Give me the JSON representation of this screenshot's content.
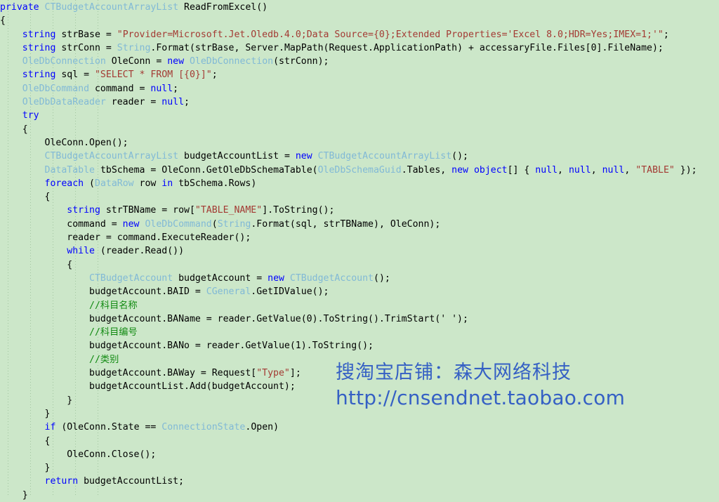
{
  "editor": {
    "background_color": "#cce7c9",
    "language": "C#",
    "syntax_colors": {
      "keyword": "#0000ff",
      "type": "#81b9d6",
      "string": "#a33a33",
      "comment": "#118a11",
      "plain": "#000000"
    },
    "indent_guide_color": "#9bbf99",
    "indent_guide_x_positions": [
      11,
      43,
      75,
      107,
      139
    ],
    "code_lines": [
      [
        {
          "t": "kw",
          "s": "private"
        },
        {
          "t": "pln",
          "s": " "
        },
        {
          "t": "typ",
          "s": "CTBudgetAccountArrayList"
        },
        {
          "t": "pln",
          "s": " ReadFromExcel()"
        }
      ],
      [
        {
          "t": "pln",
          "s": "{"
        }
      ],
      [
        {
          "t": "pln",
          "s": "    "
        },
        {
          "t": "kw",
          "s": "string"
        },
        {
          "t": "pln",
          "s": " strBase = "
        },
        {
          "t": "str",
          "s": "\"Provider=Microsoft.Jet.Oledb.4.0;Data Source={0};Extended Properties='Excel 8.0;HDR=Yes;IMEX=1;'\""
        },
        {
          "t": "pln",
          "s": ";"
        }
      ],
      [
        {
          "t": "pln",
          "s": "    "
        },
        {
          "t": "kw",
          "s": "string"
        },
        {
          "t": "pln",
          "s": " strConn = "
        },
        {
          "t": "typ",
          "s": "String"
        },
        {
          "t": "pln",
          "s": ".Format(strBase, Server.MapPath(Request.ApplicationPath) + accessaryFile.Files[0].FileName);"
        }
      ],
      [
        {
          "t": "pln",
          "s": "    "
        },
        {
          "t": "typ",
          "s": "OleDbConnection"
        },
        {
          "t": "pln",
          "s": " OleConn = "
        },
        {
          "t": "kw",
          "s": "new"
        },
        {
          "t": "pln",
          "s": " "
        },
        {
          "t": "typ",
          "s": "OleDbConnection"
        },
        {
          "t": "pln",
          "s": "(strConn);"
        }
      ],
      [
        {
          "t": "pln",
          "s": "    "
        },
        {
          "t": "kw",
          "s": "string"
        },
        {
          "t": "pln",
          "s": " sql = "
        },
        {
          "t": "str",
          "s": "\"SELECT * FROM [{0}]\""
        },
        {
          "t": "pln",
          "s": ";"
        }
      ],
      [
        {
          "t": "pln",
          "s": "    "
        },
        {
          "t": "typ",
          "s": "OleDbCommand"
        },
        {
          "t": "pln",
          "s": " command = "
        },
        {
          "t": "kw",
          "s": "null"
        },
        {
          "t": "pln",
          "s": ";"
        }
      ],
      [
        {
          "t": "pln",
          "s": "    "
        },
        {
          "t": "typ",
          "s": "OleDbDataReader"
        },
        {
          "t": "pln",
          "s": " reader = "
        },
        {
          "t": "kw",
          "s": "null"
        },
        {
          "t": "pln",
          "s": ";"
        }
      ],
      [
        {
          "t": "pln",
          "s": "    "
        },
        {
          "t": "kw",
          "s": "try"
        }
      ],
      [
        {
          "t": "pln",
          "s": "    {"
        }
      ],
      [
        {
          "t": "pln",
          "s": "        OleConn.Open();"
        }
      ],
      [
        {
          "t": "pln",
          "s": "        "
        },
        {
          "t": "typ",
          "s": "CTBudgetAccountArrayList"
        },
        {
          "t": "pln",
          "s": " budgetAccountList = "
        },
        {
          "t": "kw",
          "s": "new"
        },
        {
          "t": "pln",
          "s": " "
        },
        {
          "t": "typ",
          "s": "CTBudgetAccountArrayList"
        },
        {
          "t": "pln",
          "s": "();"
        }
      ],
      [
        {
          "t": "pln",
          "s": "        "
        },
        {
          "t": "typ",
          "s": "DataTable"
        },
        {
          "t": "pln",
          "s": " tbSchema = OleConn.GetOleDbSchemaTable("
        },
        {
          "t": "typ",
          "s": "OleDbSchemaGuid"
        },
        {
          "t": "pln",
          "s": ".Tables, "
        },
        {
          "t": "kw",
          "s": "new"
        },
        {
          "t": "pln",
          "s": " "
        },
        {
          "t": "kw",
          "s": "object"
        },
        {
          "t": "pln",
          "s": "[] { "
        },
        {
          "t": "kw",
          "s": "null"
        },
        {
          "t": "pln",
          "s": ", "
        },
        {
          "t": "kw",
          "s": "null"
        },
        {
          "t": "pln",
          "s": ", "
        },
        {
          "t": "kw",
          "s": "null"
        },
        {
          "t": "pln",
          "s": ", "
        },
        {
          "t": "str",
          "s": "\"TABLE\""
        },
        {
          "t": "pln",
          "s": " });"
        }
      ],
      [
        {
          "t": "pln",
          "s": "        "
        },
        {
          "t": "kw",
          "s": "foreach"
        },
        {
          "t": "pln",
          "s": " ("
        },
        {
          "t": "typ",
          "s": "DataRow"
        },
        {
          "t": "pln",
          "s": " row "
        },
        {
          "t": "kw",
          "s": "in"
        },
        {
          "t": "pln",
          "s": " tbSchema.Rows)"
        }
      ],
      [
        {
          "t": "pln",
          "s": "        {"
        }
      ],
      [
        {
          "t": "pln",
          "s": "            "
        },
        {
          "t": "kw",
          "s": "string"
        },
        {
          "t": "pln",
          "s": " strTBName = row["
        },
        {
          "t": "str",
          "s": "\"TABLE_NAME\""
        },
        {
          "t": "pln",
          "s": "].ToString();"
        }
      ],
      [
        {
          "t": "pln",
          "s": "            command = "
        },
        {
          "t": "kw",
          "s": "new"
        },
        {
          "t": "pln",
          "s": " "
        },
        {
          "t": "typ",
          "s": "OleDbCommand"
        },
        {
          "t": "pln",
          "s": "("
        },
        {
          "t": "typ",
          "s": "String"
        },
        {
          "t": "pln",
          "s": ".Format(sql, strTBName), OleConn);"
        }
      ],
      [
        {
          "t": "pln",
          "s": "            reader = command.ExecuteReader();"
        }
      ],
      [
        {
          "t": "pln",
          "s": "            "
        },
        {
          "t": "kw",
          "s": "while"
        },
        {
          "t": "pln",
          "s": " (reader.Read())"
        }
      ],
      [
        {
          "t": "pln",
          "s": "            {"
        }
      ],
      [
        {
          "t": "pln",
          "s": "                "
        },
        {
          "t": "typ",
          "s": "CTBudgetAccount"
        },
        {
          "t": "pln",
          "s": " budgetAccount = "
        },
        {
          "t": "kw",
          "s": "new"
        },
        {
          "t": "pln",
          "s": " "
        },
        {
          "t": "typ",
          "s": "CTBudgetAccount"
        },
        {
          "t": "pln",
          "s": "();"
        }
      ],
      [
        {
          "t": "pln",
          "s": "                budgetAccount.BAID = "
        },
        {
          "t": "typ",
          "s": "CGeneral"
        },
        {
          "t": "pln",
          "s": ".GetIDValue();"
        }
      ],
      [
        {
          "t": "pln",
          "s": "                "
        },
        {
          "t": "com",
          "s": "//科目名称"
        }
      ],
      [
        {
          "t": "pln",
          "s": "                budgetAccount.BAName = reader.GetValue(0).ToString().TrimStart(' ');"
        }
      ],
      [
        {
          "t": "pln",
          "s": "                "
        },
        {
          "t": "com",
          "s": "//科目编号"
        }
      ],
      [
        {
          "t": "pln",
          "s": "                budgetAccount.BANo = reader.GetValue(1).ToString();"
        }
      ],
      [
        {
          "t": "pln",
          "s": "                "
        },
        {
          "t": "com",
          "s": "//类别"
        }
      ],
      [
        {
          "t": "pln",
          "s": "                budgetAccount.BAWay = Request["
        },
        {
          "t": "str",
          "s": "\"Type\""
        },
        {
          "t": "pln",
          "s": "];"
        }
      ],
      [
        {
          "t": "pln",
          "s": "                budgetAccountList.Add(budgetAccount);"
        }
      ],
      [
        {
          "t": "pln",
          "s": "            }"
        }
      ],
      [
        {
          "t": "pln",
          "s": "        }"
        }
      ],
      [
        {
          "t": "pln",
          "s": "        "
        },
        {
          "t": "kw",
          "s": "if"
        },
        {
          "t": "pln",
          "s": " (OleConn.State == "
        },
        {
          "t": "typ",
          "s": "ConnectionState"
        },
        {
          "t": "pln",
          "s": ".Open)"
        }
      ],
      [
        {
          "t": "pln",
          "s": "        {"
        }
      ],
      [
        {
          "t": "pln",
          "s": "            OleConn.Close();"
        }
      ],
      [
        {
          "t": "pln",
          "s": "        }"
        }
      ],
      [
        {
          "t": "pln",
          "s": "        "
        },
        {
          "t": "kw",
          "s": "return"
        },
        {
          "t": "pln",
          "s": " budgetAccountList;"
        }
      ],
      [
        {
          "t": "pln",
          "s": "    }"
        }
      ]
    ]
  },
  "watermark": {
    "line1": "搜淘宝店铺：森大网络科技",
    "line2": "http://cnsendnet.taobao.com",
    "color": "#3560c4"
  }
}
